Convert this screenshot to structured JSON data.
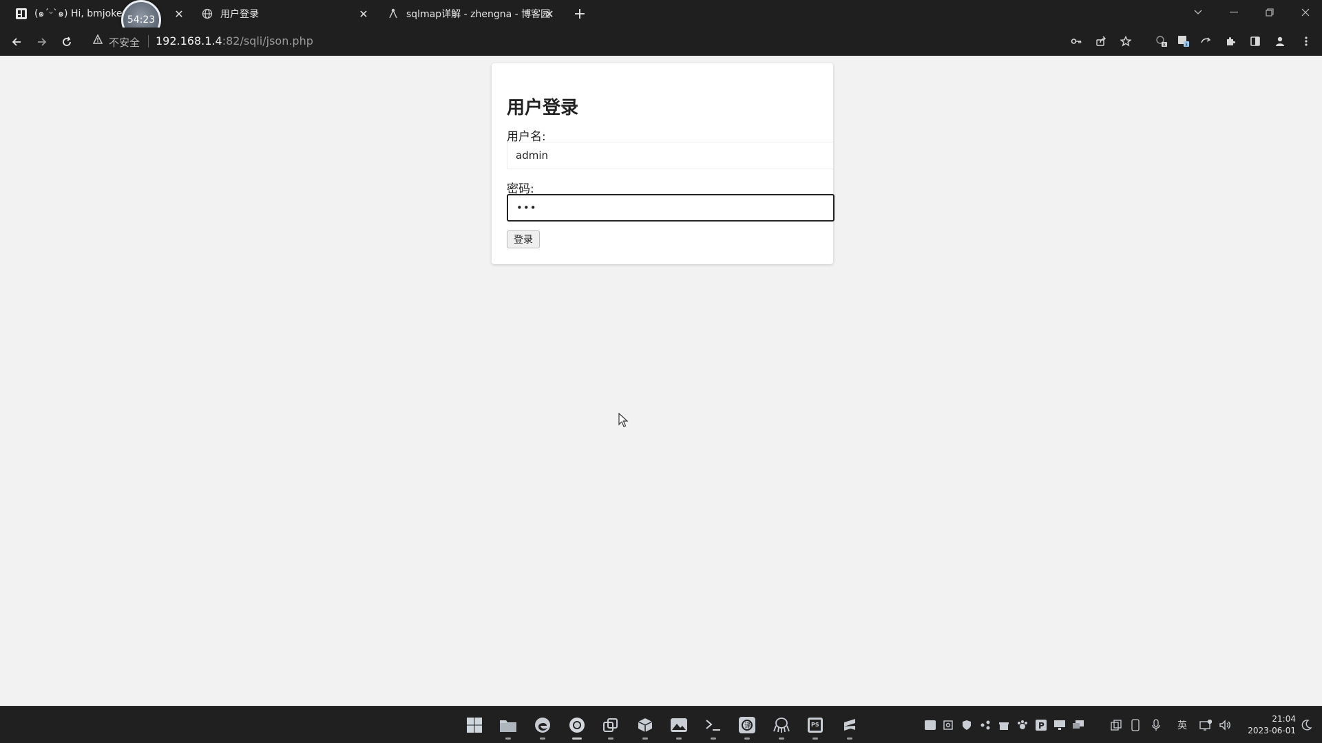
{
  "browser": {
    "tabs": [
      {
        "title": "(๑´ᵕ`๑) Hi, bmjoker",
        "favicon": "bmjoker-favicon",
        "close": "✕"
      },
      {
        "title": "用户登录",
        "favicon": "globe-icon",
        "close": "✕"
      },
      {
        "title": "sqlmap详解 - zhengna - 博客园",
        "favicon": "cnblogs-icon",
        "close": "✕"
      }
    ],
    "new_tab": "+",
    "recording_timer": "54:23",
    "address": {
      "security_label": "不安全",
      "host": "192.168.1.4",
      "path": ":82/sqli/json.php"
    }
  },
  "page": {
    "heading": "用户登录",
    "username_label": "用户名:",
    "username_value": "admin",
    "password_label": "密码:",
    "password_value": "•••",
    "login_button": "登录"
  },
  "taskbar": {
    "apps": [
      "start-icon",
      "file-explorer-icon",
      "edge-icon",
      "chrome-icon",
      "virtual-machine-icon",
      "package-icon",
      "photos-icon",
      "terminal-icon",
      "translator-icon",
      "octopus-icon",
      "phpstorm-icon",
      "sublime-icon"
    ],
    "ime": "英",
    "time": "21:04",
    "date": "2023-06-01"
  },
  "colors": {
    "chrome_dark": "#1f1f1f",
    "page_bg": "#f2f2f2",
    "card_bg": "#ffffff",
    "taskbar": "#202020"
  }
}
